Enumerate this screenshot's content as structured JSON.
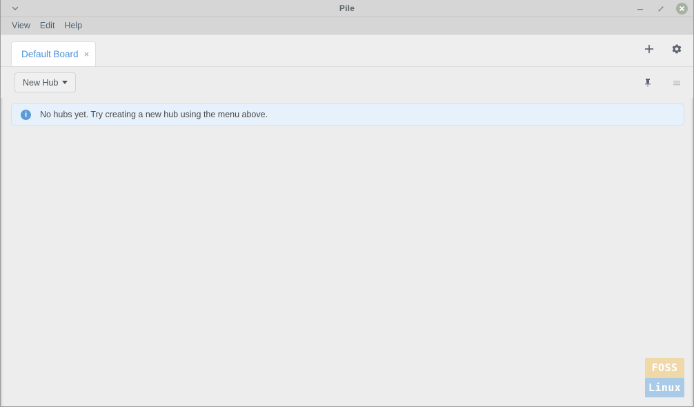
{
  "window": {
    "title": "Pile",
    "caret_icon": "chevron-down-icon",
    "controls": {
      "minimize_label": "–",
      "maximize_label": "⤡",
      "close_label": "✕"
    }
  },
  "menubar": {
    "items": [
      {
        "label": "View"
      },
      {
        "label": "Edit"
      },
      {
        "label": "Help"
      }
    ]
  },
  "tabbar": {
    "tabs": [
      {
        "label": "Default Board",
        "close_label": "×",
        "active": true
      }
    ],
    "actions": [
      {
        "name": "add-board-button",
        "icon": "plus-icon"
      },
      {
        "name": "settings-button",
        "icon": "gear-icon"
      }
    ]
  },
  "hub_toolbar": {
    "new_hub_label": "New Hub",
    "actions": [
      {
        "name": "pin-button",
        "icon": "pin-icon"
      },
      {
        "name": "menu-button",
        "icon": "hamburger-icon"
      }
    ]
  },
  "content": {
    "banner": {
      "icon": "info-icon",
      "icon_glyph": "i",
      "message": "No hubs yet. Try creating a new hub using the menu above."
    }
  },
  "watermark": {
    "line1": "FOSS",
    "line2": "Linux"
  },
  "colors": {
    "accent_blue": "#4a90d9",
    "banner_bg": "#e7f1fb",
    "banner_border": "#cfe2f5",
    "info_blue": "#5b9bd8",
    "titlebar_bg": "#d6d6d6",
    "window_bg": "#ededed",
    "close_button_bg": "#a8b0a2",
    "watermark_top": "#efd9a8",
    "watermark_bottom": "#a9cbe8"
  }
}
